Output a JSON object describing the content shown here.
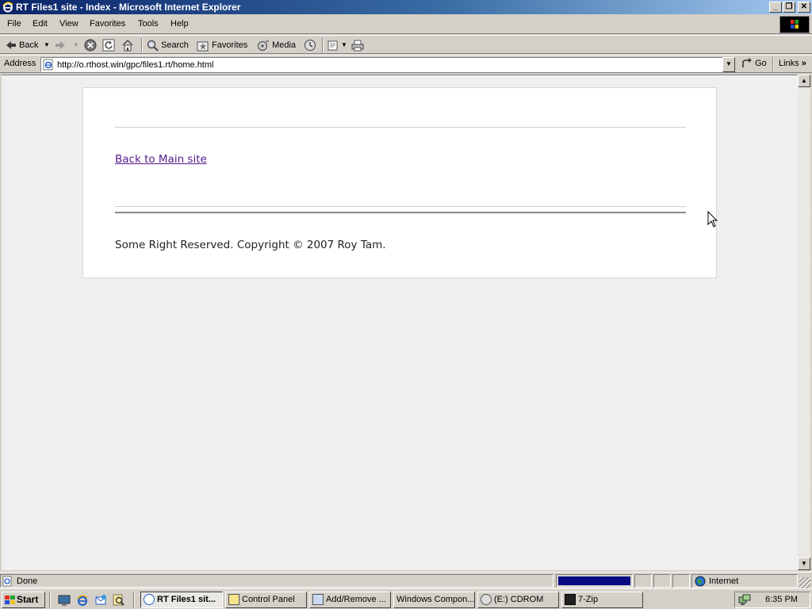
{
  "window": {
    "title": "RT Files1 site - Index - Microsoft Internet Explorer",
    "minimize_glyph": "_",
    "maximize_glyph": "❐",
    "close_glyph": "✕"
  },
  "menu": {
    "items": [
      "File",
      "Edit",
      "View",
      "Favorites",
      "Tools",
      "Help"
    ]
  },
  "toolbar": {
    "back_label": "Back",
    "search_label": "Search",
    "favorites_label": "Favorites",
    "media_label": "Media"
  },
  "address_bar": {
    "label": "Address",
    "url": "http://o.rthost.win/gpc/files1.rt/home.html",
    "go_label": "Go",
    "links_label": "Links"
  },
  "page": {
    "back_link_text": "Back to Main site",
    "copyright_text": "Some Right Reserved. Copyright © 2007 Roy Tam."
  },
  "status_bar": {
    "status_text": "Done",
    "zone_text": "Internet"
  },
  "taskbar": {
    "start_label": "Start",
    "tasks": [
      {
        "label": "RT Files1 sit...",
        "active": true
      },
      {
        "label": "Control Panel",
        "active": false
      },
      {
        "label": "Add/Remove ...",
        "active": false
      },
      {
        "label": "Windows Compon...",
        "active": false
      },
      {
        "label": "(E:) CDROM",
        "active": false
      },
      {
        "label": "7-Zip",
        "active": false
      }
    ],
    "clock": "6:35 PM"
  },
  "colors": {
    "titlebar_start": "#0a246a",
    "titlebar_end": "#a6caf0",
    "link_visited": "#551a8b",
    "chrome_face": "#d4d0c8",
    "content_bg": "#efefef",
    "progress_fill": "#0a0a84"
  }
}
